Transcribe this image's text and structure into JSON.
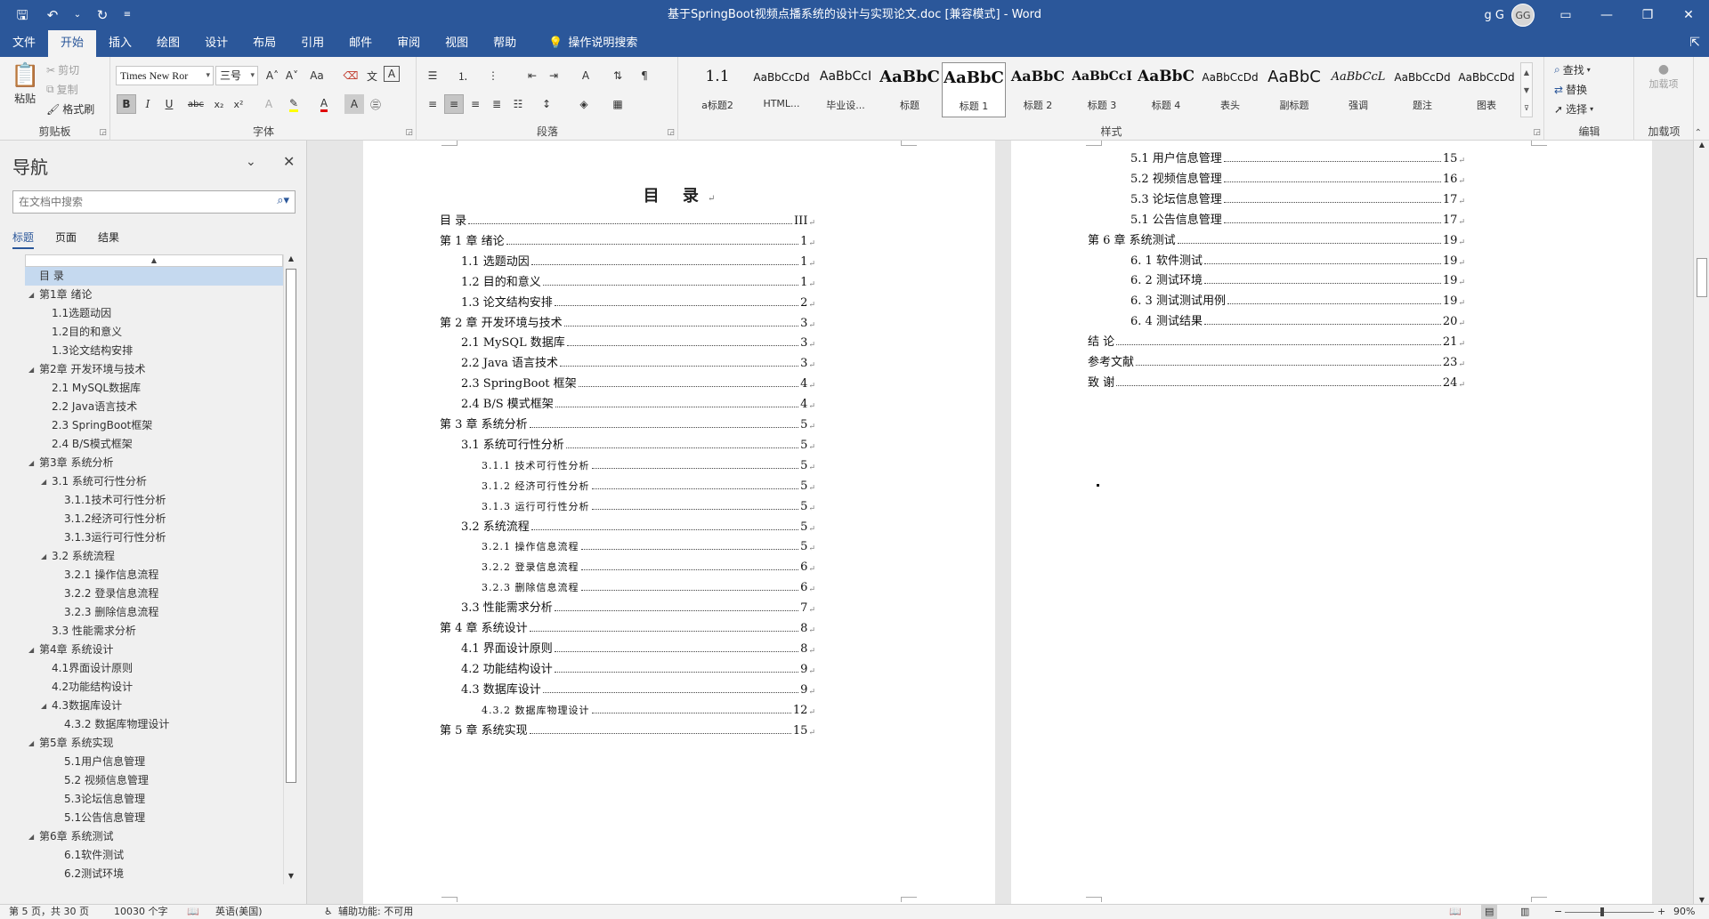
{
  "window": {
    "title": "基于SpringBoot视频点播系统的设计与实现论文.doc [兼容模式]  -  Word",
    "user_name": "g G",
    "avatar_initials": "GG",
    "controls": [
      "▭",
      "—",
      "❐",
      "✕"
    ]
  },
  "quick_access": {
    "save_icon": "save-icon",
    "undo_icon": "undo-icon",
    "redo_icon": "redo-icon"
  },
  "tabs": [
    "文件",
    "开始",
    "插入",
    "绘图",
    "设计",
    "布局",
    "引用",
    "邮件",
    "审阅",
    "视图",
    "帮助"
  ],
  "active_tab": "开始",
  "tell_me": "操作说明搜索",
  "ribbon": {
    "clipboard": {
      "label": "剪贴板",
      "paste": "粘贴",
      "cut": "剪切",
      "copy": "复制",
      "format_painter": "格式刷"
    },
    "font": {
      "label": "字体",
      "font_name": "Times New Ror",
      "font_size": "三号",
      "grow": "A˄",
      "shrink": "A˅",
      "case": "Aa",
      "bold": "B",
      "italic": "I",
      "underline": "U",
      "strike": "abc",
      "subscript": "x₂",
      "superscript": "x²"
    },
    "paragraph": {
      "label": "段落"
    },
    "styles": {
      "label": "样式",
      "items": [
        {
          "preview": "1.1",
          "name": "a标题2"
        },
        {
          "preview": "AaBbCcDd",
          "name": "HTML..."
        },
        {
          "preview": "AaBbCcI",
          "name": "毕业设..."
        },
        {
          "preview": "AaBbC",
          "name": "标题"
        },
        {
          "preview": "AaBbC",
          "name": "标题 1"
        },
        {
          "preview": "AaBbC",
          "name": "标题 2"
        },
        {
          "preview": "AaBbCcI",
          "name": "标题 3"
        },
        {
          "preview": "AaBbC",
          "name": "标题 4"
        },
        {
          "preview": "AaBbCcDd",
          "name": "表头"
        },
        {
          "preview": "AaBbC",
          "name": "副标题"
        },
        {
          "preview": "AaBbCcL",
          "name": "强调"
        },
        {
          "preview": "AaBbCcDd",
          "name": "题注"
        },
        {
          "preview": "AaBbCcDd",
          "name": "图表"
        }
      ],
      "selected_index": 4
    },
    "editing": {
      "label": "编辑",
      "find": "查找",
      "replace": "替换",
      "select": "选择"
    },
    "addins": {
      "label": "加载项",
      "load": "加载项"
    }
  },
  "nav_pane": {
    "title": "导航",
    "search_placeholder": "在文档中搜索",
    "tabs": [
      "标题",
      "页面",
      "结果"
    ],
    "active_tab": "标题",
    "items": [
      {
        "text": "目  录",
        "level": 1,
        "expander": "",
        "selected": true
      },
      {
        "text": "第1章  绪论",
        "level": 1,
        "expander": "◢"
      },
      {
        "text": "1.1选题动因",
        "level": 2,
        "expander": ""
      },
      {
        "text": "1.2目的和意义",
        "level": 2,
        "expander": ""
      },
      {
        "text": "1.3论文结构安排",
        "level": 2,
        "expander": ""
      },
      {
        "text": "第2章  开发环境与技术",
        "level": 1,
        "expander": "◢"
      },
      {
        "text": "2.1 MySQL数据库",
        "level": 2,
        "expander": ""
      },
      {
        "text": "2.2 Java语言技术",
        "level": 2,
        "expander": ""
      },
      {
        "text": "2.3 SpringBoot框架",
        "level": 2,
        "expander": ""
      },
      {
        "text": "2.4 B/S模式框架",
        "level": 2,
        "expander": ""
      },
      {
        "text": "第3章  系统分析",
        "level": 1,
        "expander": "◢"
      },
      {
        "text": "3.1 系统可行性分析",
        "level": 2,
        "expander": "◢"
      },
      {
        "text": "3.1.1技术可行性分析",
        "level": 3,
        "expander": ""
      },
      {
        "text": "3.1.2经济可行性分析",
        "level": 3,
        "expander": ""
      },
      {
        "text": "3.1.3运行可行性分析",
        "level": 3,
        "expander": ""
      },
      {
        "text": "3.2 系统流程",
        "level": 2,
        "expander": "◢"
      },
      {
        "text": "3.2.1 操作信息流程",
        "level": 3,
        "expander": ""
      },
      {
        "text": "3.2.2 登录信息流程",
        "level": 3,
        "expander": ""
      },
      {
        "text": "3.2.3 删除信息流程",
        "level": 3,
        "expander": ""
      },
      {
        "text": "3.3 性能需求分析",
        "level": 2,
        "expander": ""
      },
      {
        "text": "第4章  系统设计",
        "level": 1,
        "expander": "◢"
      },
      {
        "text": "4.1界面设计原则",
        "level": 2,
        "expander": ""
      },
      {
        "text": "4.2功能结构设计",
        "level": 2,
        "expander": ""
      },
      {
        "text": "4.3数据库设计",
        "level": 2,
        "expander": "◢"
      },
      {
        "text": "4.3.2 数据库物理设计",
        "level": 3,
        "expander": ""
      },
      {
        "text": "第5章  系统实现",
        "level": 1,
        "expander": "◢"
      },
      {
        "text": "5.1用户信息管理",
        "level": 3,
        "expander": ""
      },
      {
        "text": "5.2 视频信息管理",
        "level": 3,
        "expander": ""
      },
      {
        "text": "5.3论坛信息管理",
        "level": 3,
        "expander": ""
      },
      {
        "text": "5.1公告信息管理",
        "level": 3,
        "expander": ""
      },
      {
        "text": "第6章  系统测试",
        "level": 1,
        "expander": "◢"
      },
      {
        "text": "6.1软件测试",
        "level": 3,
        "expander": ""
      },
      {
        "text": "6.2测试环境",
        "level": 3,
        "expander": ""
      }
    ]
  },
  "document": {
    "page1": {
      "heading": "目  录",
      "entries": [
        {
          "text": "目  录",
          "page": "III",
          "level": 1
        },
        {
          "text": "第 1 章  绪论",
          "page": "1",
          "level": 1
        },
        {
          "text": "1.1 选题动因",
          "page": "1",
          "level": 2
        },
        {
          "text": "1.2 目的和意义",
          "page": "1",
          "level": 2
        },
        {
          "text": "1.3 论文结构安排",
          "page": "2",
          "level": 2
        },
        {
          "text": "第 2 章  开发环境与技术",
          "page": "3",
          "level": 1
        },
        {
          "text": "2.1 MySQL 数据库",
          "page": "3",
          "level": 2
        },
        {
          "text": "2.2 Java 语言技术",
          "page": "3",
          "level": 2
        },
        {
          "text": "2.3 SpringBoot 框架",
          "page": "4",
          "level": 2
        },
        {
          "text": "2.4 B/S 模式框架",
          "page": "4",
          "level": 2
        },
        {
          "text": "第 3 章  系统分析",
          "page": "5",
          "level": 1
        },
        {
          "text": "3.1  系统可行性分析",
          "page": "5",
          "level": 2
        },
        {
          "text": "3.1.1  技术可行性分析",
          "page": "5",
          "level": 3
        },
        {
          "text": "3.1.2  经济可行性分析",
          "page": "5",
          "level": 3
        },
        {
          "text": "3.1.3  运行可行性分析",
          "page": "5",
          "level": 3
        },
        {
          "text": "3.2  系统流程",
          "page": "5",
          "level": 2
        },
        {
          "text": "3.2.1  操作信息流程",
          "page": "5",
          "level": 3
        },
        {
          "text": "3.2.2  登录信息流程",
          "page": "6",
          "level": 3
        },
        {
          "text": "3.2.3  删除信息流程",
          "page": "6",
          "level": 3
        },
        {
          "text": "3.3  性能需求分析",
          "page": "7",
          "level": 2
        },
        {
          "text": "第 4 章  系统设计",
          "page": "8",
          "level": 1
        },
        {
          "text": "4.1 界面设计原则",
          "page": "8",
          "level": 2
        },
        {
          "text": "4.2 功能结构设计",
          "page": "9",
          "level": 2
        },
        {
          "text": "4.3 数据库设计",
          "page": "9",
          "level": 2
        },
        {
          "text": "4.3.2  数据库物理设计",
          "page": "12",
          "level": 3
        },
        {
          "text": "第 5 章  系统实现",
          "page": "15",
          "level": 1
        }
      ]
    },
    "page2": {
      "entries": [
        {
          "text": "5.1 用户信息管理",
          "page": "15",
          "level": 2
        },
        {
          "text": "5.2  视频信息管理",
          "page": "16",
          "level": 2
        },
        {
          "text": "5.3 论坛信息管理",
          "page": "17",
          "level": 2
        },
        {
          "text": "5.1 公告信息管理",
          "page": "17",
          "level": 2
        },
        {
          "text": "第 6 章  系统测试",
          "page": "19",
          "level": 1
        },
        {
          "text": "6. 1 软件测试",
          "page": "19",
          "level": 2
        },
        {
          "text": "6. 2 测试环境",
          "page": "19",
          "level": 2
        },
        {
          "text": "6. 3 测试测试用例",
          "page": "19",
          "level": 2
        },
        {
          "text": "6. 4 测试结果",
          "page": "20",
          "level": 2
        },
        {
          "text": "结    论",
          "page": "21",
          "level": 1
        },
        {
          "text": "参考文献",
          "page": "23",
          "level": 1
        },
        {
          "text": "致    谢",
          "page": "24",
          "level": 1
        }
      ]
    },
    "paragraph_mark": "↵"
  },
  "status_bar": {
    "page_info": "第 5 页，共 30 页",
    "word_count": "10030 个字",
    "language": "英语(美国)",
    "accessibility": "辅助功能: 不可用",
    "zoom": "90%"
  },
  "colors": {
    "accent": "#2b579a",
    "ribbon_bg": "#f3f3f3",
    "nav_selected": "#c5d9ef"
  }
}
